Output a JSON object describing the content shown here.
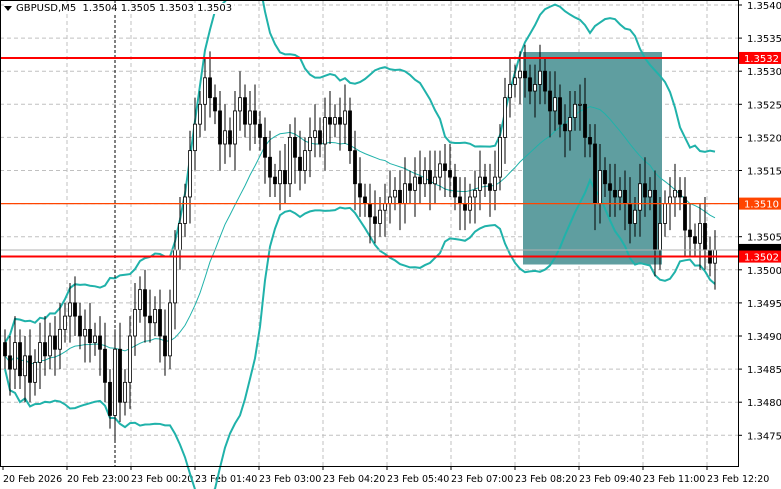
{
  "header": {
    "symbol_timeframe": "GBPUSD,M5",
    "open": "1.3504",
    "high": "1.3505",
    "low": "1.3503",
    "close": "1.3503"
  },
  "colors": {
    "level_red": "#ff0000",
    "level_orange": "#ff4500",
    "band": "#20b2aa",
    "zone": "#5f9ea0"
  },
  "chart_data": {
    "type": "candlestick",
    "title": "GBPUSD,M5",
    "ylim": [
      1.347,
      1.3542
    ],
    "y_ticks": [
      "1.3540",
      "1.3535",
      "1.3530",
      "1.3525",
      "1.3520",
      "1.3515",
      "1.3510",
      "1.3505",
      "1.3500",
      "1.3495",
      "1.3490",
      "1.3485",
      "1.3480",
      "1.3475"
    ],
    "x_ticks": [
      "20 Feb 2026",
      "20 Feb 23:00",
      "23 Feb 00:20",
      "23 Feb 01:40",
      "23 Feb 03:00",
      "23 Feb 04:20",
      "23 Feb 05:40",
      "23 Feb 07:00",
      "23 Feb 08:20",
      "23 Feb 09:40",
      "23 Feb 11:00",
      "23 Feb 12:20"
    ],
    "close": [
      1.3487,
      1.3485,
      1.3489,
      1.3484,
      1.3487,
      1.3483,
      1.3486,
      1.3489,
      1.3487,
      1.349,
      1.3488,
      1.3491,
      1.3493,
      1.3495,
      1.3493,
      1.349,
      1.3491,
      1.3489,
      1.349,
      1.3488,
      1.3483,
      1.3478,
      1.3488,
      1.348,
      1.3483,
      1.349,
      1.3494,
      1.3497,
      1.3493,
      1.3492,
      1.3494,
      1.349,
      1.3487,
      1.3495,
      1.3503,
      1.3507,
      1.3511,
      1.3518,
      1.3522,
      1.3525,
      1.3529,
      1.3526,
      1.3524,
      1.3519,
      1.3521,
      1.3519,
      1.3524,
      1.3526,
      1.3522,
      1.3524,
      1.3522,
      1.352,
      1.3517,
      1.3514,
      1.3513,
      1.3515,
      1.3513,
      1.352,
      1.3517,
      1.3515,
      1.3518,
      1.352,
      1.3521,
      1.3519,
      1.3523,
      1.3522,
      1.3523,
      1.3522,
      1.3524,
      1.3518,
      1.3513,
      1.3511,
      1.351,
      1.3508,
      1.3507,
      1.3509,
      1.351,
      1.3511,
      1.3512,
      1.351,
      1.3513,
      1.3512,
      1.3514,
      1.3513,
      1.3515,
      1.3513,
      1.3514,
      1.3516,
      1.3515,
      1.3514,
      1.3511,
      1.351,
      1.3509,
      1.3511,
      1.3512,
      1.3514,
      1.3513,
      1.3512,
      1.3514,
      1.352,
      1.3526,
      1.3528,
      1.3529,
      1.353,
      1.3529,
      1.3527,
      1.3528,
      1.353,
      1.3527,
      1.3524,
      1.3526,
      1.3522,
      1.3521,
      1.3523,
      1.3525,
      1.3525,
      1.352,
      1.3519,
      1.351,
      1.3515,
      1.3513,
      1.3512,
      1.3511,
      1.3512,
      1.351,
      1.3507,
      1.3509,
      1.3513,
      1.3511,
      1.3512,
      1.3503,
      1.3507,
      1.351,
      1.3511,
      1.3512,
      1.3511,
      1.3506,
      1.3505,
      1.3504,
      1.3507,
      1.3503,
      1.3501,
      1.3503
    ],
    "levels": [
      {
        "price": 1.3532,
        "label": "1.3532",
        "color": "#ff0000"
      },
      {
        "price": 1.351,
        "label": "1.3510",
        "color": "#ff4500"
      },
      {
        "price": 1.3502,
        "label": "1.3502",
        "color": "#ff0000"
      }
    ],
    "bid": 1.3503,
    "zone": {
      "from_bar": 104,
      "to_bar": 131,
      "top": 1.35329,
      "bottom": 1.35008
    },
    "vline_bar": 22,
    "indicator": "Bollinger Bands (20, 2)"
  }
}
